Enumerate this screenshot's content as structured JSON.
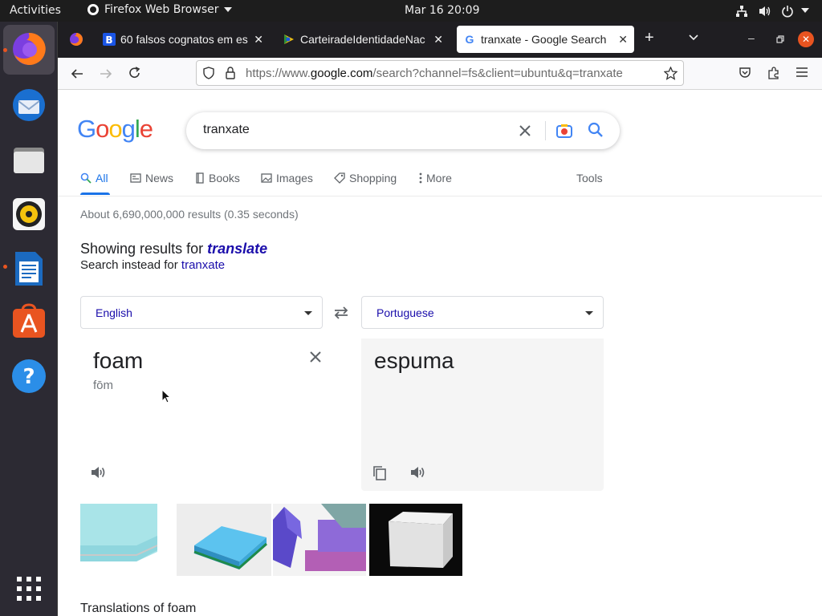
{
  "topbar": {
    "activities": "Activities",
    "app_name": "Firefox Web Browser",
    "datetime": "Mar 16  20:09"
  },
  "tabs": [
    {
      "label": "60 falsos cognatos em es"
    },
    {
      "label": "CarteiradeIdentidadeNac"
    },
    {
      "label": "tranxate - Google Search"
    }
  ],
  "url": {
    "prefix": "https://www.",
    "domain": "google.com",
    "path": "/search?channel=fs&client=ubuntu&q=tranxate"
  },
  "google": {
    "logo": "Google",
    "query": "tranxate",
    "nav": [
      "All",
      "News",
      "Books",
      "Images",
      "Shopping",
      "More"
    ],
    "tools": "Tools",
    "stats": "About 6,690,000,000 results (0.35 seconds)",
    "showing_prefix": "Showing results for ",
    "showing_term": "translate",
    "instead_prefix": "Search instead for ",
    "instead_term": "tranxate"
  },
  "translate": {
    "source_lang": "English",
    "target_lang": "Portuguese",
    "source_text": "foam",
    "pronunciation": "fōm",
    "target_text": "espuma"
  },
  "footer": {
    "translations_heading": "Translations of foam"
  },
  "colors": {
    "accent": "#1a73e8",
    "link": "#1a0dab",
    "ubuntu_orange": "#e95420"
  }
}
